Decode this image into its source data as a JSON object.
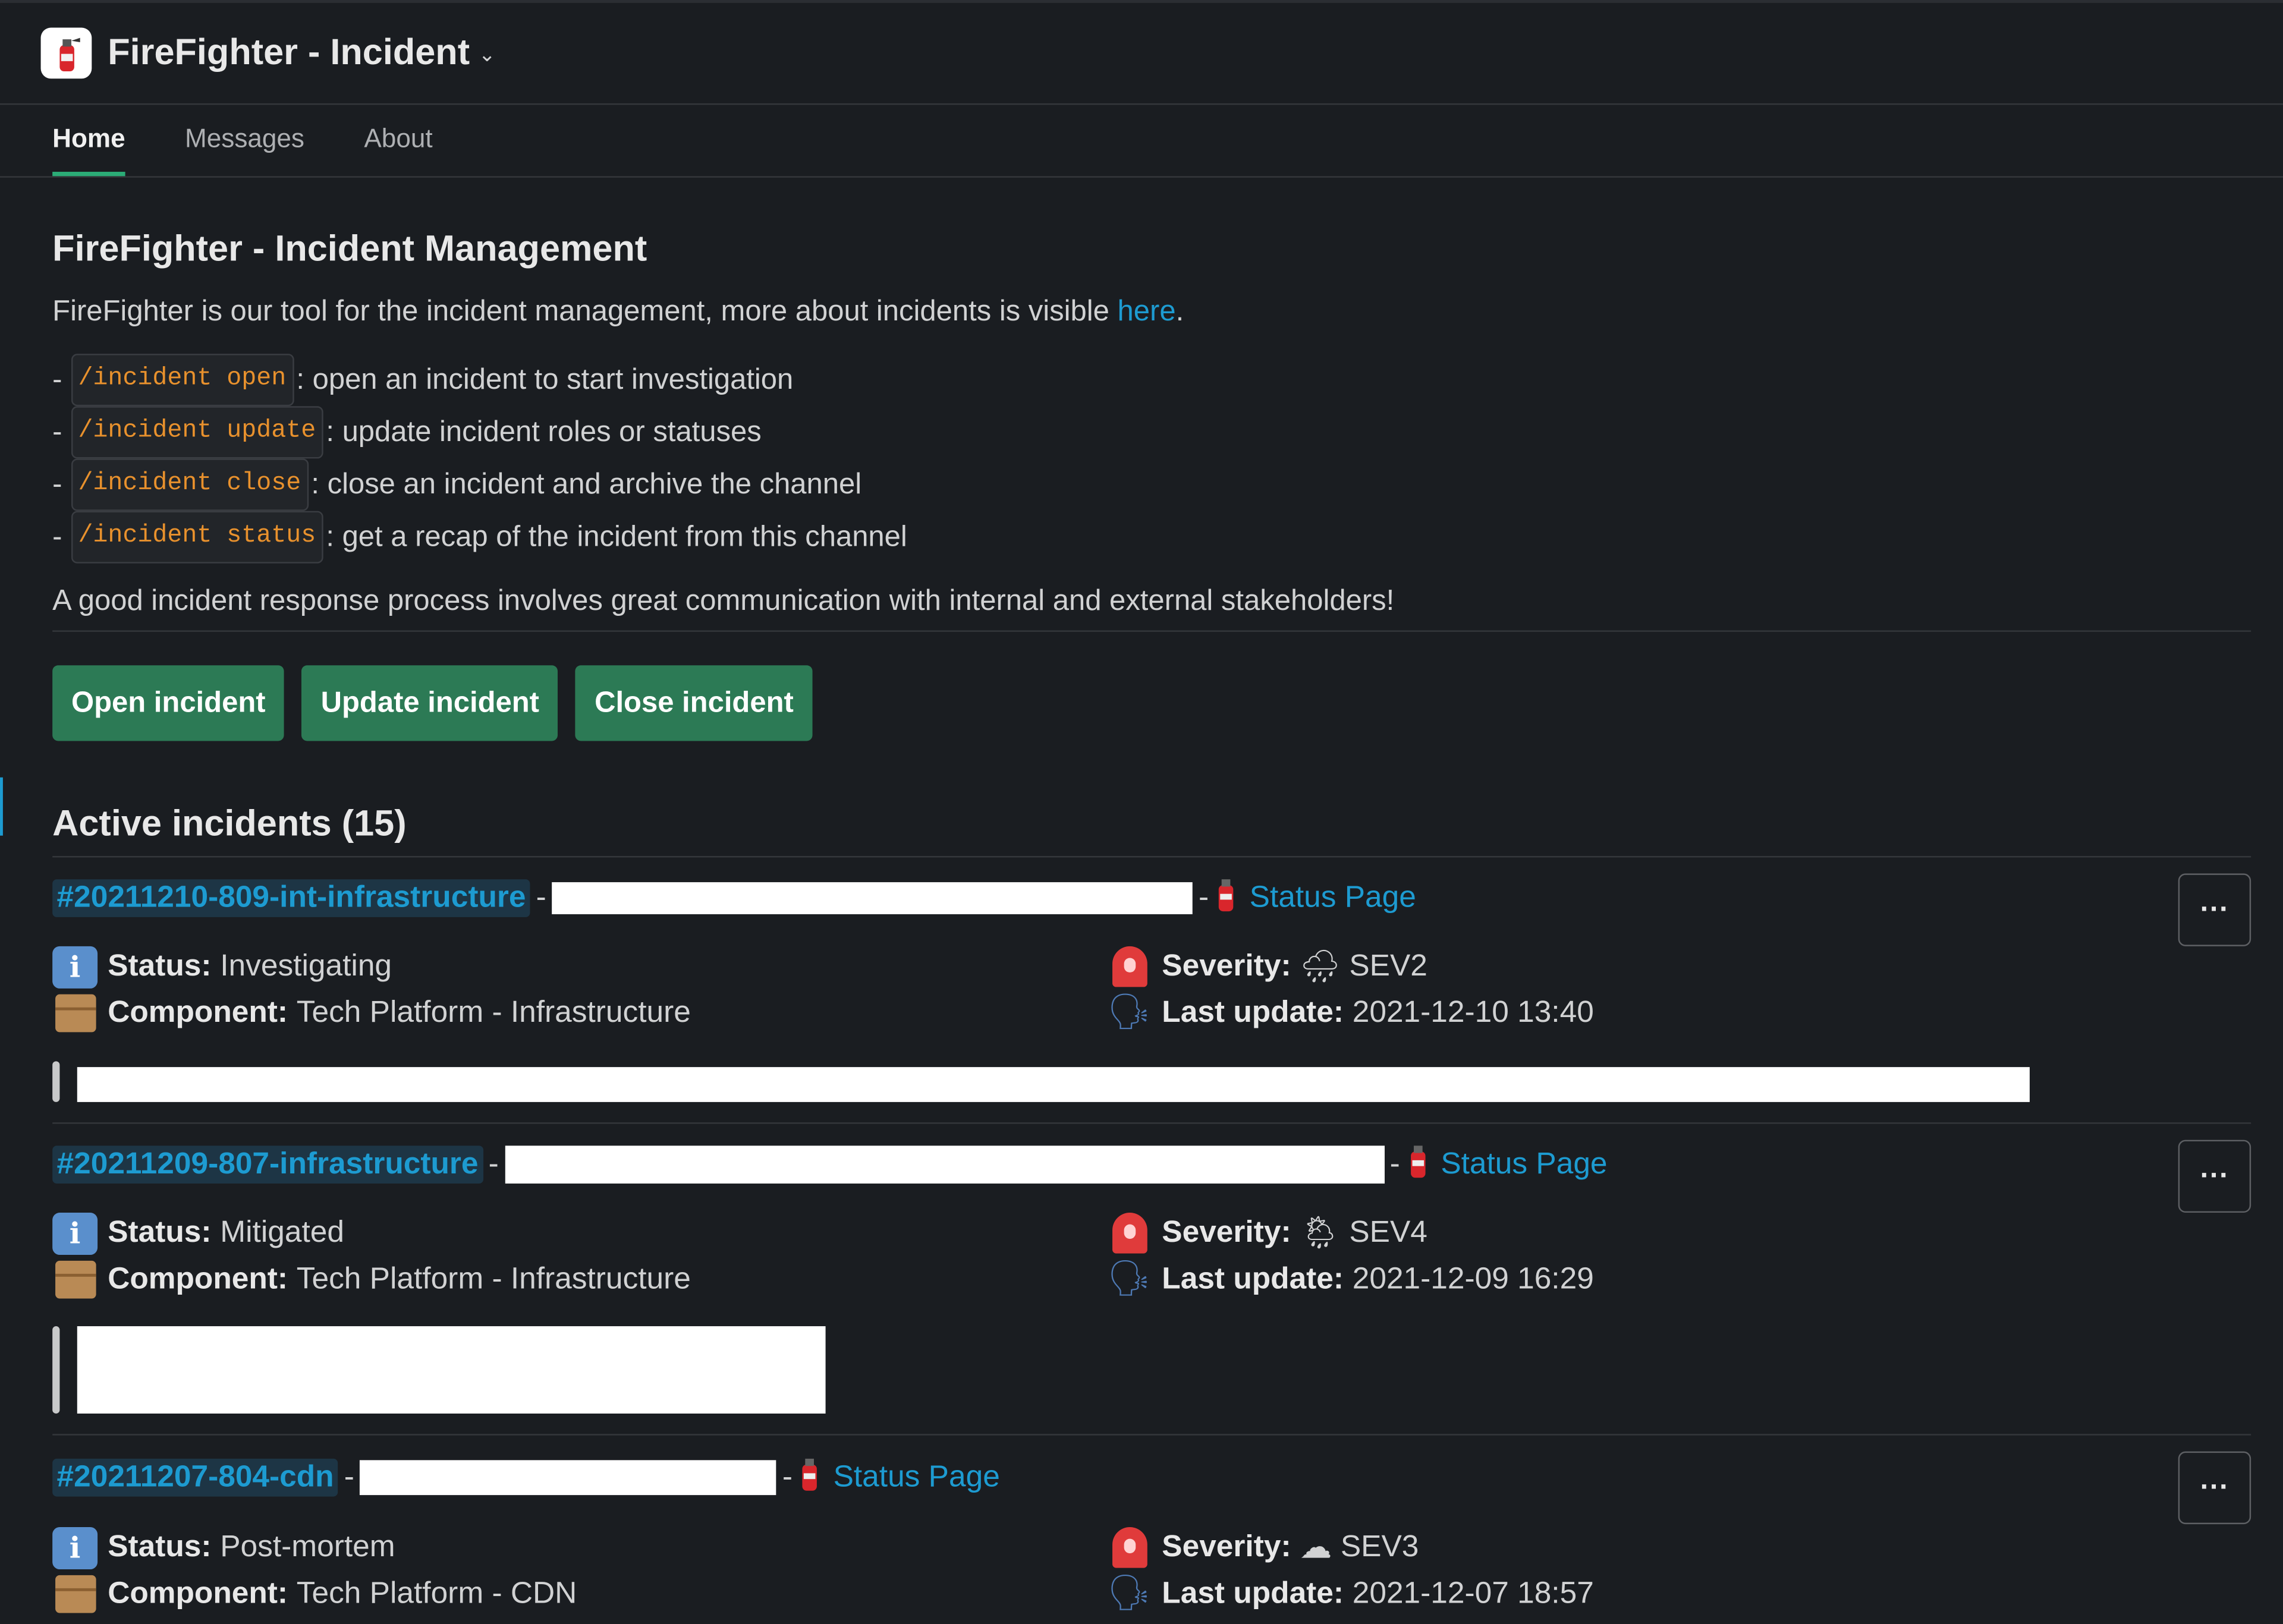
{
  "app": {
    "title": "FireFighter - Incident",
    "logo_icon": "fire-extinguisher-icon"
  },
  "tabs": [
    {
      "label": "Home",
      "active": true
    },
    {
      "label": "Messages",
      "active": false
    },
    {
      "label": "About",
      "active": false
    }
  ],
  "home": {
    "title": "FireFighter - Incident Management",
    "intro_text": "FireFighter is our tool for the incident management, more about incidents is visible ",
    "intro_link": "here",
    "intro_end": ".",
    "commands": [
      {
        "cmd": "/incident open",
        "desc": ": open an incident to start investigation"
      },
      {
        "cmd": "/incident update",
        "desc": ": update incident roles or statuses"
      },
      {
        "cmd": "/incident close",
        "desc": ": close an incident and archive the channel"
      },
      {
        "cmd": "/incident status",
        "desc": ": get a recap of the incident from this channel"
      }
    ],
    "footer_note": "A good incident response process involves great communication with internal and external stakeholders!",
    "buttons": {
      "open": "Open incident",
      "update": "Update incident",
      "close": "Close incident"
    },
    "active_title": "Active incidents (15)"
  },
  "labels": {
    "status": "Status:",
    "component": "Component:",
    "severity": "Severity:",
    "last_update": "Last update:",
    "status_page": "Status Page",
    "dash": "-",
    "more": "···"
  },
  "incidents": [
    {
      "channel": "#20211210-809-int-infrastructure",
      "status": "Investigating",
      "component": "Tech Platform - Infrastructure",
      "severity": "SEV2",
      "weather_icon": "cloud-rain-icon",
      "last_update": "2021-12-10 13:40"
    },
    {
      "channel": "#20211209-807-infrastructure",
      "status": "Mitigated",
      "component": "Tech Platform - Infrastructure",
      "severity": "SEV4",
      "weather_icon": "sun-rain-icon",
      "last_update": "2021-12-09 16:29"
    },
    {
      "channel": "#20211207-804-cdn",
      "status": "Post-mortem",
      "component": "Tech Platform - CDN",
      "severity": "SEV3",
      "weather_icon": "cloud-icon",
      "last_update": "2021-12-07 18:57"
    }
  ],
  "colors": {
    "background": "#1a1d21",
    "link": "#1d9bd1",
    "button": "#2c7a55",
    "tab_underline": "#2bac76",
    "code": "#e8912d"
  }
}
